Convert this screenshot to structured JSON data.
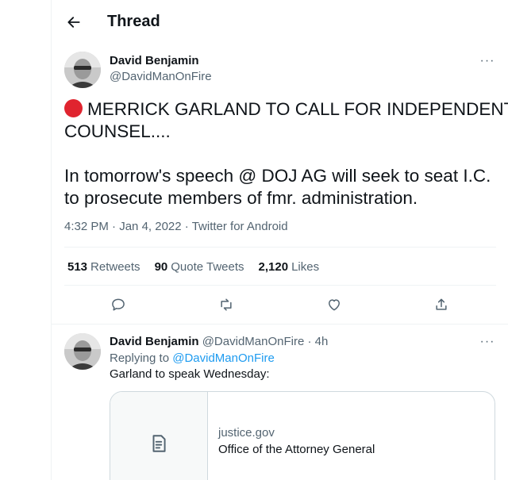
{
  "header": {
    "title": "Thread"
  },
  "tweet": {
    "author_name": "David Benjamin",
    "author_handle": "@DavidManOnFire",
    "text_line1": "MERRICK GARLAND TO CALL FOR INDEPENDENT",
    "text_line2": "COUNSEL....",
    "text_line3": "In tomorrow's speech @ DOJ AG will seek to seat I.C.",
    "text_line4": "to prosecute members of fmr. administration.",
    "time": "4:32 PM",
    "date": "Jan 4, 2022",
    "source": "Twitter for Android",
    "meta_sep": "·"
  },
  "stats": [
    {
      "count": "513",
      "label": "Retweets"
    },
    {
      "count": "90",
      "label": "Quote Tweets"
    },
    {
      "count": "2,120",
      "label": "Likes"
    }
  ],
  "actions": [
    "reply-icon",
    "retweet-icon",
    "like-icon",
    "share-icon"
  ],
  "reply": {
    "author_name": "David Benjamin",
    "author_handle": "@DavidManOnFire",
    "age": "· 4h",
    "replying_prefix": "Replying to",
    "replying_handle": "@DavidManOnFire",
    "text": "Garland to speak Wednesday:",
    "card": {
      "domain": "justice.gov",
      "title": "Office of the Attorney General"
    }
  },
  "more_label": "···",
  "colors": {
    "accent": "#1d9bf0",
    "muted": "#536471",
    "red_circle": "#e0242f"
  }
}
